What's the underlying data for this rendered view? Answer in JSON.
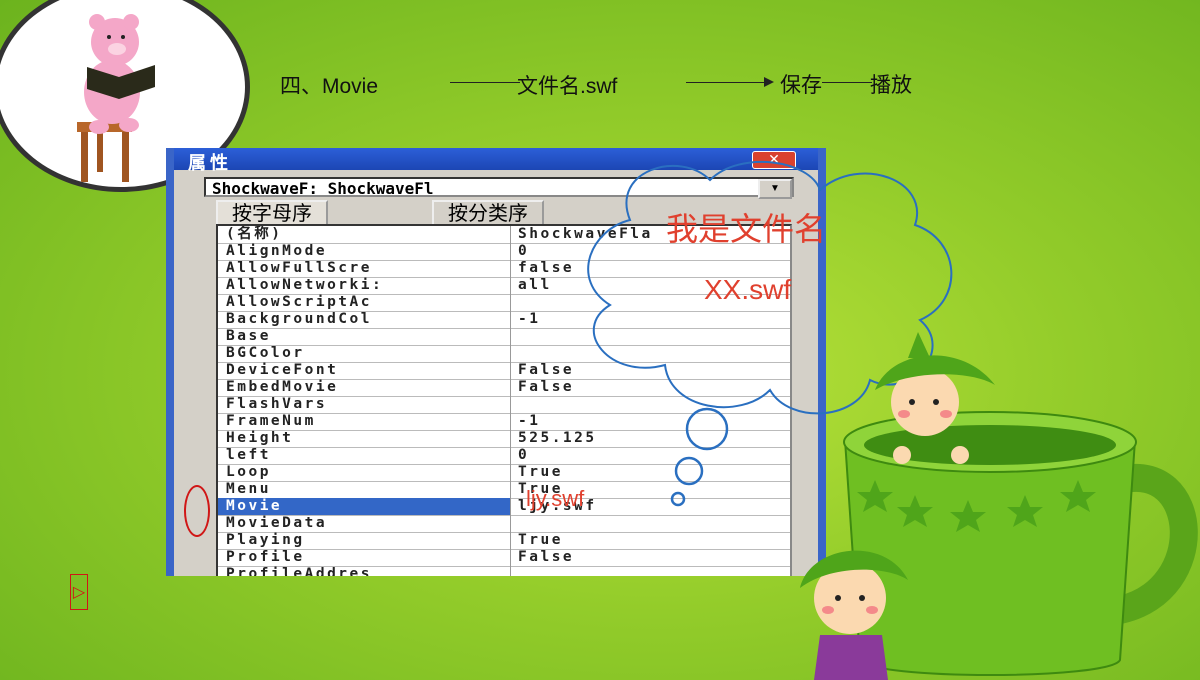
{
  "heading": {
    "step": "四、Movie",
    "filename": "文件名.swf",
    "save": "保存",
    "play": "播放"
  },
  "window": {
    "title": "属性",
    "close_label": "✕",
    "object_selector": "ShockwaveF: ShockwaveFl",
    "dropdown_icon": "▼",
    "tabs": [
      "按字母序",
      "按分类序"
    ],
    "properties": [
      {
        "name": "(名称)",
        "value": "ShockwaveFla"
      },
      {
        "name": "AlignMode",
        "value": "0"
      },
      {
        "name": "AllowFullScre",
        "value": "false"
      },
      {
        "name": "AllowNetworki:",
        "value": "all"
      },
      {
        "name": "AllowScriptAc",
        "value": ""
      },
      {
        "name": "BackgroundCol",
        "value": "-1"
      },
      {
        "name": "Base",
        "value": ""
      },
      {
        "name": "BGColor",
        "value": ""
      },
      {
        "name": "DeviceFont",
        "value": "False"
      },
      {
        "name": "EmbedMovie",
        "value": "False"
      },
      {
        "name": "FlashVars",
        "value": ""
      },
      {
        "name": "FrameNum",
        "value": "-1"
      },
      {
        "name": "Height",
        "value": "525.125"
      },
      {
        "name": "left",
        "value": "0"
      },
      {
        "name": "Loop",
        "value": "True"
      },
      {
        "name": "Menu",
        "value": "True"
      },
      {
        "name": "Movie",
        "value": "ljy.swf",
        "selected": true
      },
      {
        "name": "MovieData",
        "value": ""
      },
      {
        "name": "Playing",
        "value": "True"
      },
      {
        "name": "Profile",
        "value": "False"
      },
      {
        "name": "ProfileAddres",
        "value": ""
      }
    ]
  },
  "cloud": {
    "line1": "我是文件名",
    "line2": "XX.swf"
  },
  "overlay_value": "ljy.swf",
  "play_button": "▷",
  "colors": {
    "background": "#93cc2a",
    "titlebar": "#2c5fd8",
    "selection": "#3367c7",
    "cloud_stroke": "#2a6fc0",
    "annotation_red": "#e0402e"
  }
}
